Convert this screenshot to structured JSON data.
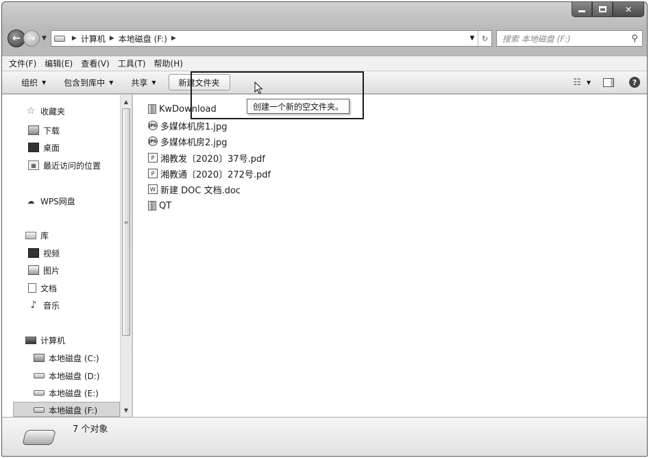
{
  "address": {
    "path": [
      "计算机",
      "本地磁盘 (F:)"
    ]
  },
  "search": {
    "placeholder": "搜索 本地磁盘 (F:)"
  },
  "menu": [
    "文件(F)",
    "编辑(E)",
    "查看(V)",
    "工具(T)",
    "帮助(H)"
  ],
  "toolbar": {
    "organize": "组织",
    "include_library": "包含到库中",
    "share": "共享",
    "new_folder": "新建文件夹"
  },
  "tooltip": "创建一个新的空文件夹。",
  "nav": {
    "favorites": "收藏夹",
    "downloads": "下载",
    "desktop": "桌面",
    "recent": "最近访问的位置",
    "wps": "WPS网盘",
    "libraries": "库",
    "videos": "视频",
    "pictures": "图片",
    "documents": "文档",
    "music": "音乐",
    "computer": "计算机",
    "drive_c": "本地磁盘 (C:)",
    "drive_d": "本地磁盘 (D:)",
    "drive_e": "本地磁盘 (E:)",
    "drive_f": "本地磁盘 (F:)"
  },
  "files": [
    {
      "name": "KwDownload",
      "icon": "folder-icon"
    },
    {
      "name": "多媒体机房1.jpg",
      "icon": "jpg-icon"
    },
    {
      "name": "多媒体机房2.jpg",
      "icon": "jpg-icon"
    },
    {
      "name": "湘教发〔2020〕37号.pdf",
      "icon": "pdf-icon"
    },
    {
      "name": "湘教通〔2020〕272号.pdf",
      "icon": "pdf-icon"
    },
    {
      "name": "新建 DOC 文档.doc",
      "icon": "doc-icon"
    },
    {
      "name": "QT",
      "icon": "folder-icon"
    }
  ],
  "status": {
    "count": "7 个对象"
  }
}
